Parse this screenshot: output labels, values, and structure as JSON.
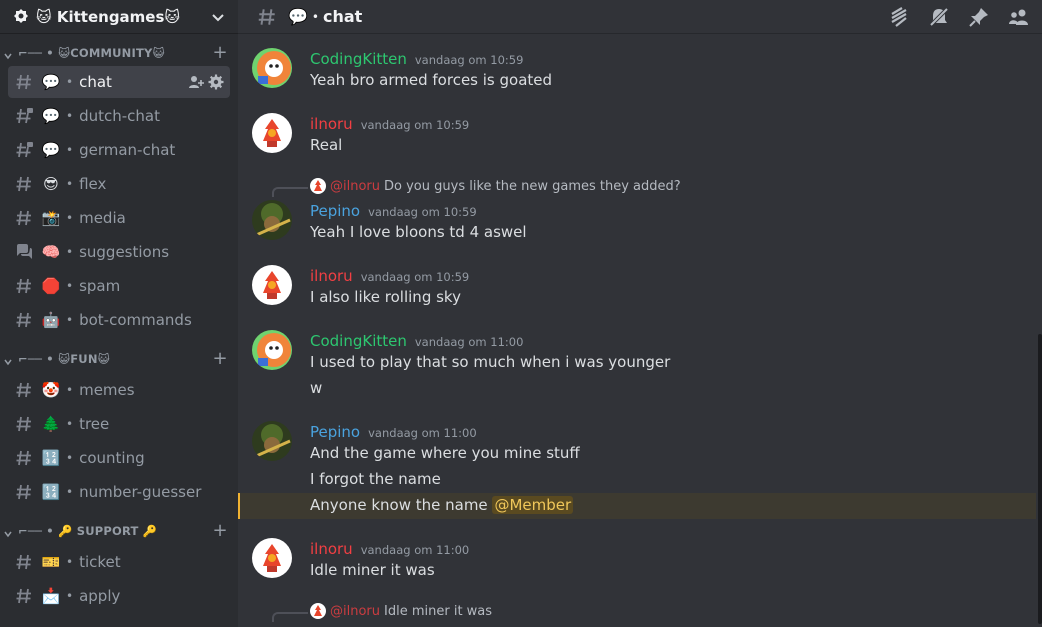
{
  "server": {
    "name": "🐱 Kittengames🐱"
  },
  "categories": [
    {
      "label": "⌐── • 😺COMMUNITY😺"
    },
    {
      "label": "⌐── • 😺FUN😺"
    },
    {
      "label": "⌐── • 🔑 SUPPORT 🔑"
    }
  ],
  "channels": [
    {
      "emoji": "💬",
      "name": "chat",
      "icon": "hash-icon",
      "active": true
    },
    {
      "emoji": "💬",
      "name": "dutch-chat",
      "icon": "hash-lock-icon"
    },
    {
      "emoji": "💬",
      "name": "german-chat",
      "icon": "hash-lock-icon"
    },
    {
      "emoji": "😎",
      "name": "flex",
      "icon": "hash-icon"
    },
    {
      "emoji": "📸",
      "name": "media",
      "icon": "hash-icon"
    },
    {
      "emoji": "🧠",
      "name": "suggestions",
      "icon": "forum-icon"
    },
    {
      "emoji": "🛑",
      "name": "spam",
      "icon": "hash-icon"
    },
    {
      "emoji": "🤖",
      "name": "bot-commands",
      "icon": "hash-icon"
    },
    {
      "emoji": "🤡",
      "name": "memes",
      "icon": "hash-icon"
    },
    {
      "emoji": "🌲",
      "name": "tree",
      "icon": "hash-icon"
    },
    {
      "emoji": "🔢",
      "name": "counting",
      "icon": "hash-icon"
    },
    {
      "emoji": "🔢",
      "name": "number-guesser",
      "icon": "hash-icon"
    },
    {
      "emoji": "🎫",
      "name": "ticket",
      "icon": "hash-icon"
    },
    {
      "emoji": "📩",
      "name": "apply",
      "icon": "hash-icon"
    }
  ],
  "channel_separator": "•",
  "topbar": {
    "emoji": "💬",
    "separator": "•",
    "title": "chat"
  },
  "colors": {
    "codingkitten": "#2dc770",
    "ilnoru": "#f23f43",
    "pepino": "#4aa3df",
    "mention_bg": "#3d3a30",
    "mention_accent": "#f0b232"
  },
  "messages": [
    {
      "author": "CodingKitten",
      "time": "vandaag om 10:59",
      "lines": [
        "Yeah bro armed forces is goated"
      ]
    },
    {
      "author": "ilnoru",
      "time": "vandaag om 10:59",
      "lines": [
        "Real"
      ]
    },
    {
      "reply_mention": "@ilnoru",
      "reply_text": "Do you guys like the new games they added?",
      "author": "Pepino",
      "time": "vandaag om 10:59",
      "lines": [
        "Yeah I love bloons td 4 aswel"
      ]
    },
    {
      "author": "ilnoru",
      "time": "vandaag om 10:59",
      "lines": [
        "I also like rolling sky"
      ]
    },
    {
      "author": "CodingKitten",
      "time": "vandaag om 11:00",
      "lines": [
        "I used to play that so much when i was younger",
        "w"
      ]
    },
    {
      "author": "Pepino",
      "time": "vandaag om 11:00",
      "lines": [
        "And the game where you mine stuff",
        "I forgot the name",
        "Anyone know the name"
      ],
      "mention": "@Member"
    },
    {
      "author": "ilnoru",
      "time": "vandaag om 11:00",
      "lines": [
        "Idle miner it was"
      ]
    },
    {
      "reply_mention": "@ilnoru",
      "reply_text": "Idle miner it was"
    }
  ]
}
